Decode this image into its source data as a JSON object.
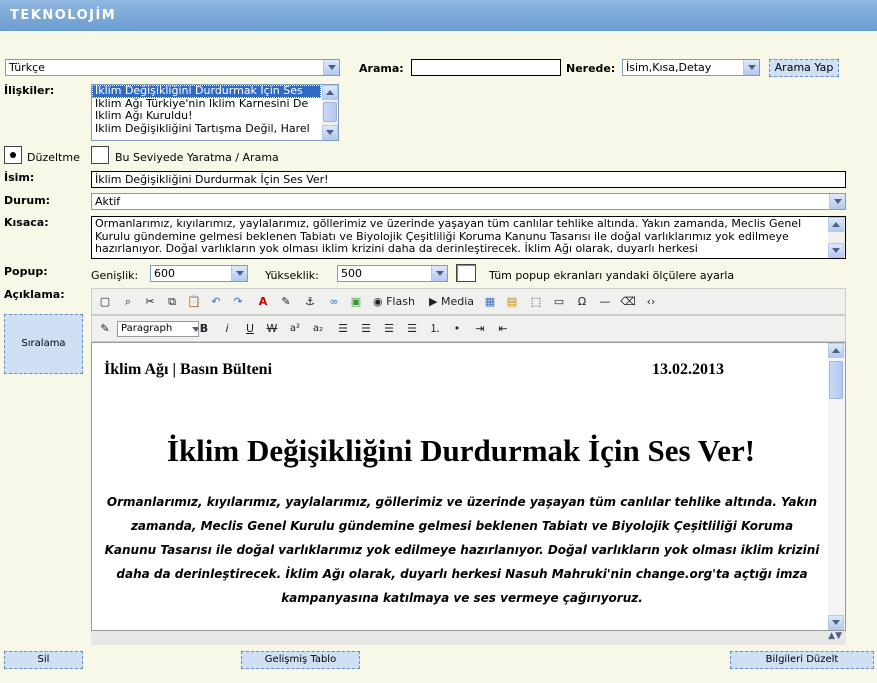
{
  "app": {
    "brand": "TEKNOLOJİM"
  },
  "colors": {
    "topbar": "#6b9dd0",
    "background": "#f8f8e8",
    "selection": "#316ac5",
    "button": "#cfe0f4"
  },
  "filters": {
    "language": "Türkçe",
    "search_label": "Arama:",
    "search_value": "",
    "where_label": "Nerede:",
    "where_value": "İsim,Kısa,Detay",
    "search_button": "Arama Yap"
  },
  "relations": {
    "label": "İlişkiler:",
    "items": [
      "İklim Değişikliğini Durdurmak İçin Ses",
      "İklim Ağı Türkiye'nin İklim Karnesini De",
      "İklim Ağı Kuruldu!",
      "İklim Değişikliğini Tartışma Değil, Harel"
    ]
  },
  "mode": {
    "edit_label": "Düzeltme",
    "create_label": "Bu Seviyede Yaratma / Arama"
  },
  "form": {
    "name_label": "İsim:",
    "name_value": "İklim Değişikliğini Durdurmak İçin Ses Ver!",
    "status_label": "Durum:",
    "status_value": "Aktif",
    "summary_label": "Kısaca:",
    "summary_value": "Ormanlarımız, kıyılarımız, yaylalarımız, göllerimiz ve üzerinde yaşayan tüm canlılar tehlike altında. Yakın zamanda, Meclis Genel Kurulu gündemine gelmesi beklenen Tabiatı ve Biyolojik Çeşitliliği Koruma Kanunu Tasarısı ile doğal varlıklarımız yok edilmeye hazırlanıyor. Doğal varlıkların yok olması iklim krizini daha da derinleştirecek.  İklim Ağı olarak, duyarlı herkesi",
    "popup_label": "Popup:",
    "width_label": "Genişlik:",
    "width_value": "600",
    "height_label": "Yükseklik:",
    "height_value": "500",
    "popup_all_label": "Tüm popup ekranları yandaki ölçülere ayarla",
    "description_label": "Açıklama:",
    "sort_button": "Sıralama"
  },
  "toolbar": {
    "flash_label": "Flash",
    "media_label": "Media",
    "format_value": "Paragraph"
  },
  "document": {
    "header_left": "İklim Ağı | Basın Bülteni",
    "header_right": "13.02.2013",
    "title": "İklim Değişikliğini Durdurmak İçin Ses Ver!",
    "body": "Ormanlarımız, kıyılarımız, yaylalarımız, göllerimiz ve üzerinde yaşayan tüm canlılar tehlike altında. Yakın zamanda, Meclis Genel Kurulu gündemine gelmesi beklenen Tabiatı ve Biyolojik Çeşitliliği Koruma Kanunu Tasarısı ile doğal varlıklarımız yok edilmeye hazırlanıyor. Doğal varlıkların yok olması iklim krizini daha da derinleştirecek.  İklim Ağı olarak, duyarlı herkesi Nasuh Mahruki'nin change.org'ta açtığı imza kampanyasına katılmaya ve ses vermeye çağırıyoruz."
  },
  "actions": {
    "delete_button": "Sil",
    "advanced_table_button": "Gelişmiş Tablo",
    "update_button": "Bilgileri Düzelt"
  }
}
